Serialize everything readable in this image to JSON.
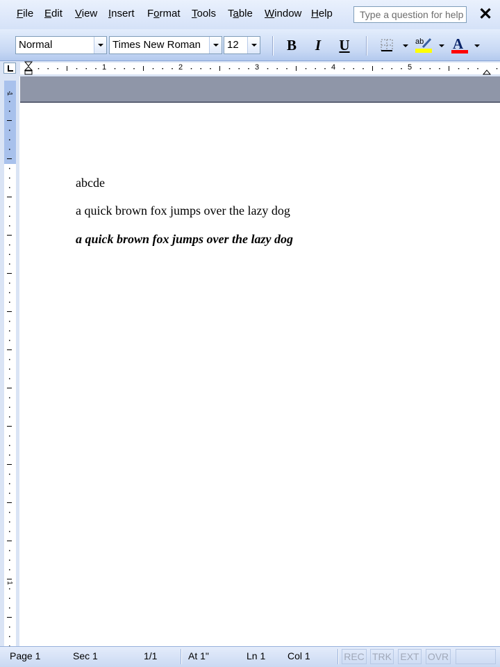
{
  "menubar": {
    "items": [
      {
        "accel": "F",
        "rest": "ile"
      },
      {
        "accel": "E",
        "rest": "dit"
      },
      {
        "accel": "V",
        "rest": "iew"
      },
      {
        "accel": "I",
        "rest": "nsert"
      },
      {
        "accel": "F",
        "pre": "",
        "rest": "ormat"
      },
      {
        "accel": "T",
        "rest": "ools"
      },
      {
        "accel": "T",
        "rest": "able"
      },
      {
        "accel": "W",
        "rest": "indow"
      },
      {
        "accel": "H",
        "rest": "elp"
      }
    ],
    "help_placeholder": "Type a question for help",
    "close_glyph": "✕"
  },
  "toolbar": {
    "style": "Normal",
    "font": "Times New Roman",
    "size": "12",
    "bold": "B",
    "italic": "I",
    "underline": "U",
    "colors": {
      "highlight": "#ffff00",
      "font_color": "#ff0000",
      "accent": "#0a246a"
    }
  },
  "ruler": {
    "numbers": [
      "1",
      "2",
      "3",
      "4",
      "5"
    ],
    "vertical_numbers": [
      "1",
      "1"
    ]
  },
  "document": {
    "lines": [
      "abcde",
      "a quick brown fox jumps over the lazy dog",
      "a quick brown fox jumps over the lazy dog"
    ]
  },
  "statusbar": {
    "page": "Page  1",
    "sec": "Sec  1",
    "pages": "1/1",
    "at": "At  1\"",
    "ln": "Ln  1",
    "col": "Col  1",
    "indicators": [
      "REC",
      "TRK",
      "EXT",
      "OVR"
    ]
  }
}
